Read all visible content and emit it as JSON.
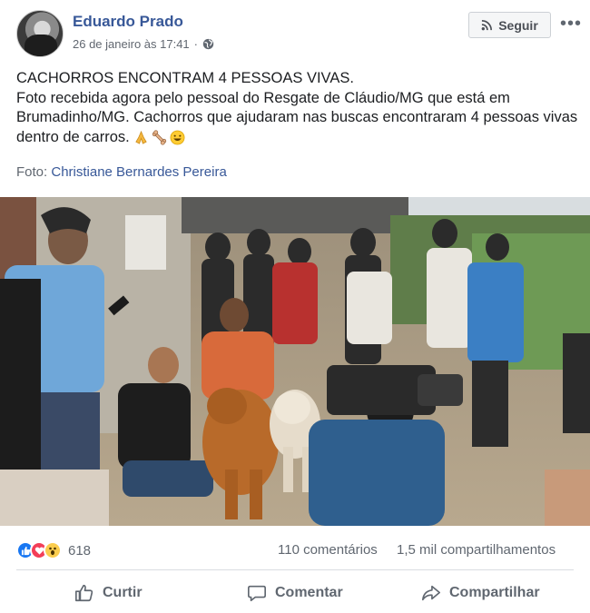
{
  "post": {
    "author": "Eduardo Prado",
    "timestamp": "26 de janeiro às 17:41",
    "privacy_icon": "globe-icon",
    "follow_label": "Seguir",
    "more_label": "•••",
    "text_line1": "CACHORROS ENCONTRAM 4 PESSOAS VIVAS.",
    "text_line2": "Foto recebida agora pelo pessoal do Resgate de Cláudio/MG que está em Brumadinho/MG. Cachorros que ajudaram nas buscas encontraram 4 pessoas vivas dentro de carros.",
    "emojis": [
      "praying-hands-emoji",
      "bone-emoji",
      "grinning-face-emoji"
    ],
    "credit_prefix": "Foto:",
    "credit_name": "Christiane Bernardes Pereira"
  },
  "stats": {
    "reactions": [
      "like",
      "love",
      "wow"
    ],
    "reaction_count": "618",
    "comments": "110 comentários",
    "shares": "1,5 mil compartilhamentos"
  },
  "actions": {
    "like": "Curtir",
    "comment": "Comentar",
    "share": "Compartilhar"
  },
  "colors": {
    "link": "#385898",
    "muted": "#606770",
    "like_blue": "#1877f2",
    "love_red": "#f33e58",
    "wow_yellow": "#fbcd4e"
  }
}
